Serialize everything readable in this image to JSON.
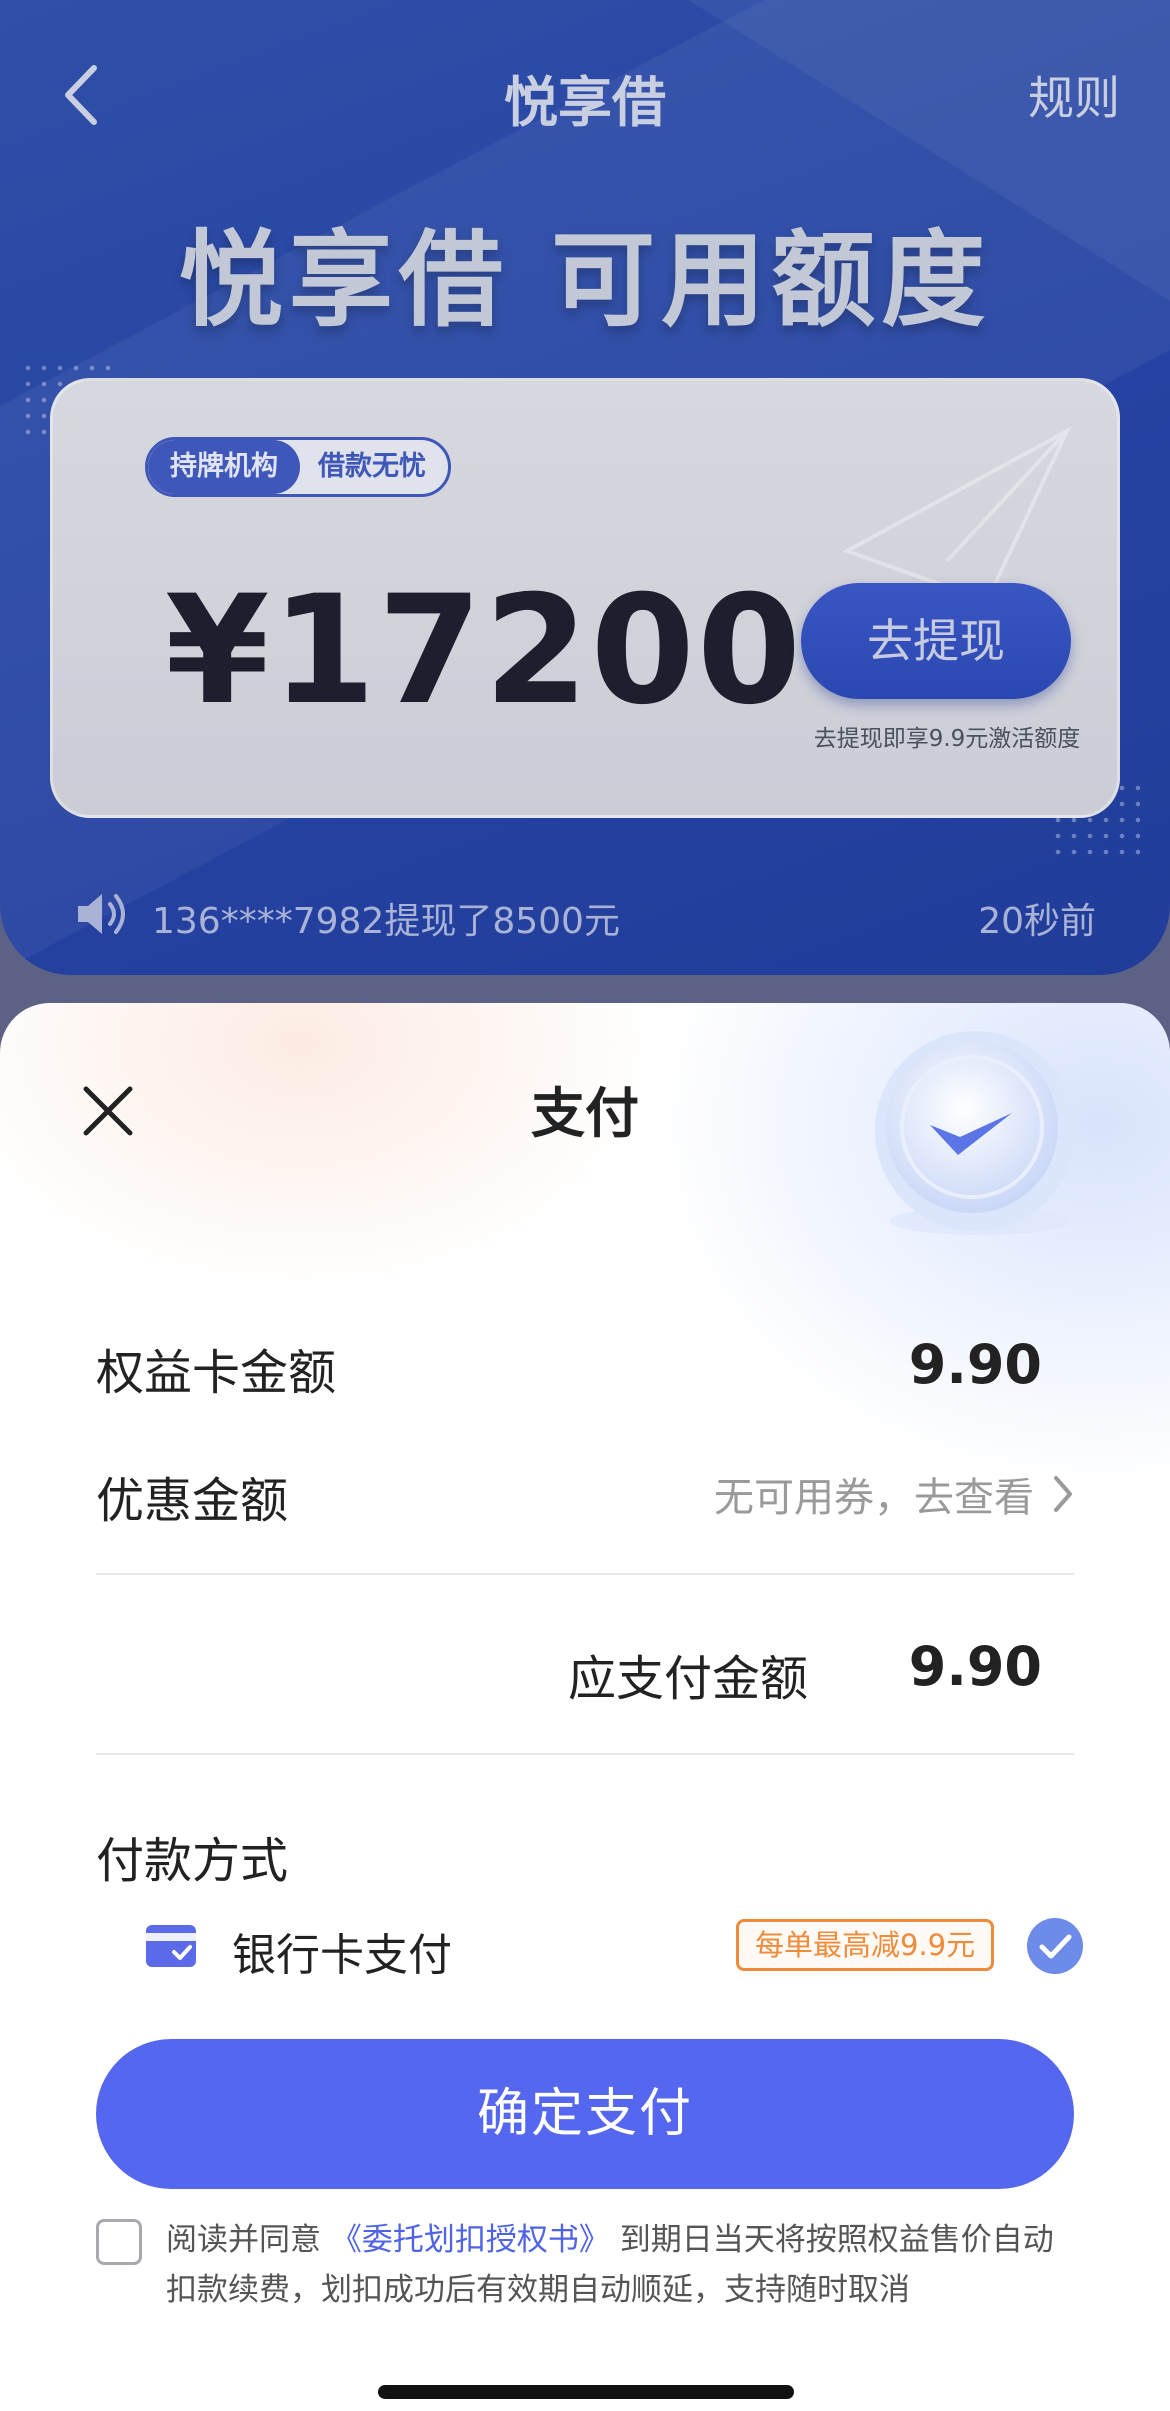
{
  "header": {
    "title": "悦享借",
    "rules_label": "规则"
  },
  "hero": {
    "title": "悦享借 可用额度"
  },
  "credit_card": {
    "tags": [
      "持牌机构",
      "借款无忧"
    ],
    "amount": "¥17200",
    "withdraw_label": "去提现",
    "withdraw_note": "去提现即享9.9元激活额度"
  },
  "ticker": {
    "message": "136****7982提现了8500元",
    "time": "20秒前"
  },
  "payment_sheet": {
    "title": "支付",
    "card_amount_label": "权益卡金额",
    "card_amount_value": "9.90",
    "discount_label": "优惠金额",
    "discount_value": "无可用券，去查看",
    "total_label": "应支付金额",
    "total_value": "9.90",
    "method_title": "付款方式",
    "method_bank_label": "银行卡支付",
    "method_promo": "每单最高减9.9元",
    "confirm_label": "确定支付",
    "agreement_prefix": "阅读并同意",
    "agreement_link": "《委托划扣授权书》",
    "agreement_suffix": "到期日当天将按照权益售价自动扣款续费，划扣成功后有效期自动顺延，支持随时取消"
  },
  "colors": {
    "primary": "#5667ef",
    "hero_blue": "#2543a2",
    "promo_orange": "#f08b3a",
    "link_blue": "#4f63e6"
  }
}
